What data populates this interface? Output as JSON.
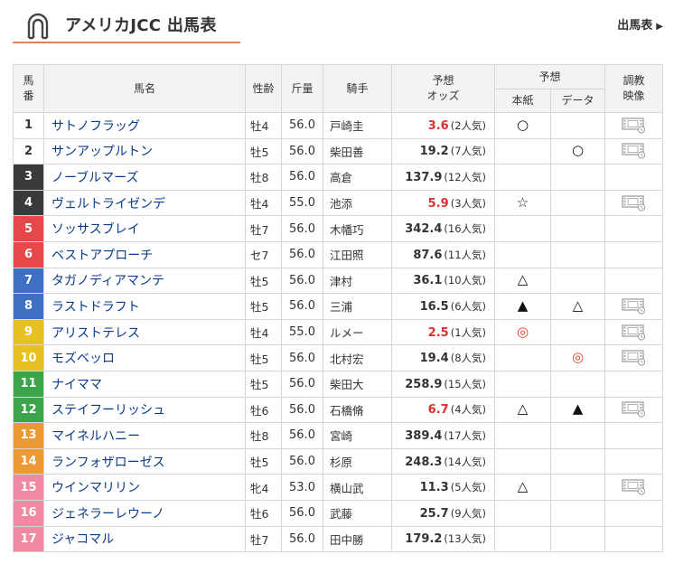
{
  "header": {
    "title": "アメリカJCC 出馬表",
    "link_label": "出馬表",
    "link_arrow": "▶",
    "accent_color": "#e1825e"
  },
  "table": {
    "headers": {
      "num": "馬\n番",
      "name": "馬名",
      "sexage": "性齢",
      "weight": "斤量",
      "jockey": "騎手",
      "odds": "予想\nオッズ",
      "forecast": "予想",
      "honshi": "本紙",
      "data": "データ",
      "video": "調教\n映像"
    },
    "popularity_suffix": "人気",
    "rows": [
      {
        "num": "1",
        "name": "サトノフラッグ",
        "sexage": "牡4",
        "weight": "56.0",
        "jockey": "戸崎圭",
        "odds": "3.6",
        "pop": "2",
        "fav": true,
        "honshi": "○",
        "data": "",
        "video": true,
        "bg": "#ffffff",
        "fg": "#333333"
      },
      {
        "num": "2",
        "name": "サンアップルトン",
        "sexage": "牡5",
        "weight": "56.0",
        "jockey": "柴田善",
        "odds": "19.2",
        "pop": "7",
        "fav": false,
        "honshi": "",
        "data": "○",
        "video": true,
        "bg": "#ffffff",
        "fg": "#333333"
      },
      {
        "num": "3",
        "name": "ノーブルマーズ",
        "sexage": "牡8",
        "weight": "56.0",
        "jockey": "高倉",
        "odds": "137.9",
        "pop": "12",
        "fav": false,
        "honshi": "",
        "data": "",
        "video": false,
        "bg": "#3a3a3a",
        "fg": "#ffffff"
      },
      {
        "num": "4",
        "name": "ヴェルトライゼンデ",
        "sexage": "牡4",
        "weight": "55.0",
        "jockey": "池添",
        "odds": "5.9",
        "pop": "3",
        "fav": true,
        "honshi": "☆",
        "data": "",
        "video": true,
        "bg": "#3a3a3a",
        "fg": "#ffffff"
      },
      {
        "num": "5",
        "name": "ソッサスブレイ",
        "sexage": "牡7",
        "weight": "56.0",
        "jockey": "木幡巧",
        "odds": "342.4",
        "pop": "16",
        "fav": false,
        "honshi": "",
        "data": "",
        "video": false,
        "bg": "#e5474b",
        "fg": "#ffffff"
      },
      {
        "num": "6",
        "name": "ベストアプローチ",
        "sexage": "セ7",
        "weight": "56.0",
        "jockey": "江田照",
        "odds": "87.6",
        "pop": "11",
        "fav": false,
        "honshi": "",
        "data": "",
        "video": false,
        "bg": "#e5474b",
        "fg": "#ffffff"
      },
      {
        "num": "7",
        "name": "タガノディアマンテ",
        "sexage": "牡5",
        "weight": "56.0",
        "jockey": "津村",
        "odds": "36.1",
        "pop": "10",
        "fav": false,
        "honshi": "△",
        "data": "",
        "video": false,
        "bg": "#3d6fc2",
        "fg": "#ffffff"
      },
      {
        "num": "8",
        "name": "ラストドラフト",
        "sexage": "牡5",
        "weight": "56.0",
        "jockey": "三浦",
        "odds": "16.5",
        "pop": "6",
        "fav": false,
        "honshi": "▲",
        "data": "△",
        "video": true,
        "bg": "#3d6fc2",
        "fg": "#ffffff"
      },
      {
        "num": "9",
        "name": "アリストテレス",
        "sexage": "牡4",
        "weight": "55.0",
        "jockey": "ルメー",
        "odds": "2.5",
        "pop": "1",
        "fav": true,
        "honshi": "◎",
        "data": "",
        "video": true,
        "bg": "#e7c022",
        "fg": "#ffffff"
      },
      {
        "num": "10",
        "name": "モズベッロ",
        "sexage": "牡5",
        "weight": "56.0",
        "jockey": "北村宏",
        "odds": "19.4",
        "pop": "8",
        "fav": false,
        "honshi": "",
        "data": "◎",
        "video": true,
        "bg": "#e7c022",
        "fg": "#ffffff"
      },
      {
        "num": "11",
        "name": "ナイママ",
        "sexage": "牡5",
        "weight": "56.0",
        "jockey": "柴田大",
        "odds": "258.9",
        "pop": "15",
        "fav": false,
        "honshi": "",
        "data": "",
        "video": false,
        "bg": "#3aa54a",
        "fg": "#ffffff"
      },
      {
        "num": "12",
        "name": "ステイフーリッシュ",
        "sexage": "牡6",
        "weight": "56.0",
        "jockey": "石橋脩",
        "odds": "6.7",
        "pop": "4",
        "fav": true,
        "honshi": "△",
        "data": "▲",
        "video": true,
        "bg": "#3aa54a",
        "fg": "#ffffff"
      },
      {
        "num": "13",
        "name": "マイネルハニー",
        "sexage": "牡8",
        "weight": "56.0",
        "jockey": "宮崎",
        "odds": "389.4",
        "pop": "17",
        "fav": false,
        "honshi": "",
        "data": "",
        "video": false,
        "bg": "#ec9a35",
        "fg": "#ffffff"
      },
      {
        "num": "14",
        "name": "ランフォザローゼス",
        "sexage": "牡5",
        "weight": "56.0",
        "jockey": "杉原",
        "odds": "248.3",
        "pop": "14",
        "fav": false,
        "honshi": "",
        "data": "",
        "video": false,
        "bg": "#ec9a35",
        "fg": "#ffffff"
      },
      {
        "num": "15",
        "name": "ウインマリリン",
        "sexage": "牝4",
        "weight": "53.0",
        "jockey": "横山武",
        "odds": "11.3",
        "pop": "5",
        "fav": false,
        "honshi": "△",
        "data": "",
        "video": true,
        "bg": "#f08aa2",
        "fg": "#ffffff"
      },
      {
        "num": "16",
        "name": "ジェネラーレウーノ",
        "sexage": "牡6",
        "weight": "56.0",
        "jockey": "武藤",
        "odds": "25.7",
        "pop": "9",
        "fav": false,
        "honshi": "",
        "data": "",
        "video": false,
        "bg": "#f08aa2",
        "fg": "#ffffff"
      },
      {
        "num": "17",
        "name": "ジャコマル",
        "sexage": "牡7",
        "weight": "56.0",
        "jockey": "田中勝",
        "odds": "179.2",
        "pop": "13",
        "fav": false,
        "honshi": "",
        "data": "",
        "video": false,
        "bg": "#f08aa2",
        "fg": "#ffffff"
      }
    ],
    "video_icon": "video-player-icon",
    "colors": {
      "favorite_odds": "#d9312b",
      "honmei_mark": "#e53a2e",
      "header_bg": "#f3f3f3",
      "border": "#d6d6d6",
      "horse_name": "#0a3a8a"
    }
  }
}
